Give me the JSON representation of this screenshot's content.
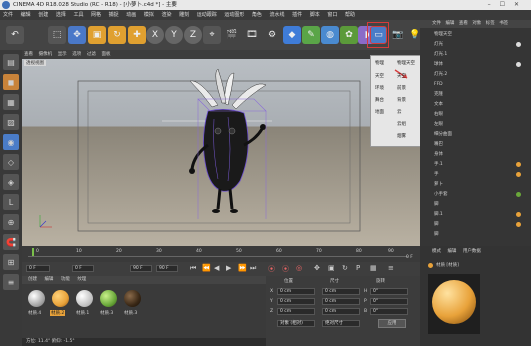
{
  "window": {
    "title": "CINEMA 4D R18.028 Studio (RC - R18) - [小萝卜.c4d *] - 主要"
  },
  "menubar": {
    "items": [
      "文件",
      "编辑",
      "创建",
      "选择",
      "工具",
      "网格",
      "捕捉",
      "动画",
      "模拟",
      "渲染",
      "雕刻",
      "运动跟踪",
      "运动图形",
      "角色",
      "流水线",
      "插件",
      "脚本",
      "窗口",
      "帮助"
    ]
  },
  "viewport": {
    "menu": [
      "查看",
      "摄像机",
      "显示",
      "选项",
      "过滤",
      "面板"
    ],
    "view_label": "透视视图"
  },
  "timeline": {
    "ticks": [
      "0",
      "10",
      "20",
      "30",
      "40",
      "50",
      "60",
      "70",
      "80",
      "90"
    ],
    "end_frame": "0 F"
  },
  "transport": {
    "start": "0 F",
    "current": "0 F",
    "end": "90 F",
    "end2": "90 F"
  },
  "materials": {
    "menu": [
      "创建",
      "编辑",
      "功能",
      "纹理"
    ],
    "items": [
      "材质.4",
      "材质.2",
      "材质.1",
      "材质.3",
      "材质.3"
    ]
  },
  "coordinates": {
    "headers": [
      "位置",
      "尺寸",
      "旋转"
    ],
    "rows": [
      {
        "axis": "X",
        "pos": "0 cm",
        "size": "0 cm",
        "rot_axis": "H",
        "rot": "0°"
      },
      {
        "axis": "Y",
        "pos": "0 cm",
        "size": "0 cm",
        "rot_axis": "P",
        "rot": "0°"
      },
      {
        "axis": "Z",
        "pos": "0 cm",
        "size": "0 cm",
        "rot_axis": "B",
        "rot": "0°"
      }
    ],
    "mode": "对象 (相对)",
    "size_mode": "绝对尺寸",
    "apply": "应用"
  },
  "status": {
    "text": "方位: 11.4°  俯仰: -1.5°"
  },
  "objects": {
    "menu": [
      "文件",
      "编辑",
      "查看",
      "对象",
      "标签",
      "书签"
    ],
    "items": [
      "物理天空",
      "灯光",
      "灯光.1",
      "球体",
      "灯光.2",
      "FFD",
      "克隆",
      "文本",
      "右眼",
      "左眼",
      "细分曲面",
      "嘴巴",
      "身体",
      "手.1",
      "手",
      "萝卜",
      "小手套",
      "脚",
      "脚.1",
      "脚",
      "脚"
    ]
  },
  "attributes": {
    "menu": [
      "模式",
      "编辑",
      "用户数据"
    ],
    "title": "材质 [材质]"
  },
  "popup": {
    "items": [
      {
        "col1": "物理",
        "col2": "物理天空"
      },
      {
        "col1": "天空",
        "col2": "天空"
      },
      {
        "col1": "环境",
        "col2": "前景"
      },
      {
        "col1": "舞台",
        "col2": "背景"
      },
      {
        "col1": "地面",
        "col2": "云"
      },
      {
        "col1": "",
        "col2": "云组"
      },
      {
        "col1": "",
        "col2": "烟雾"
      }
    ]
  },
  "colors": {
    "accent": "#e8a23a",
    "highlight_box": "#d63b3b",
    "popup_bg": "#e6e6e6"
  }
}
